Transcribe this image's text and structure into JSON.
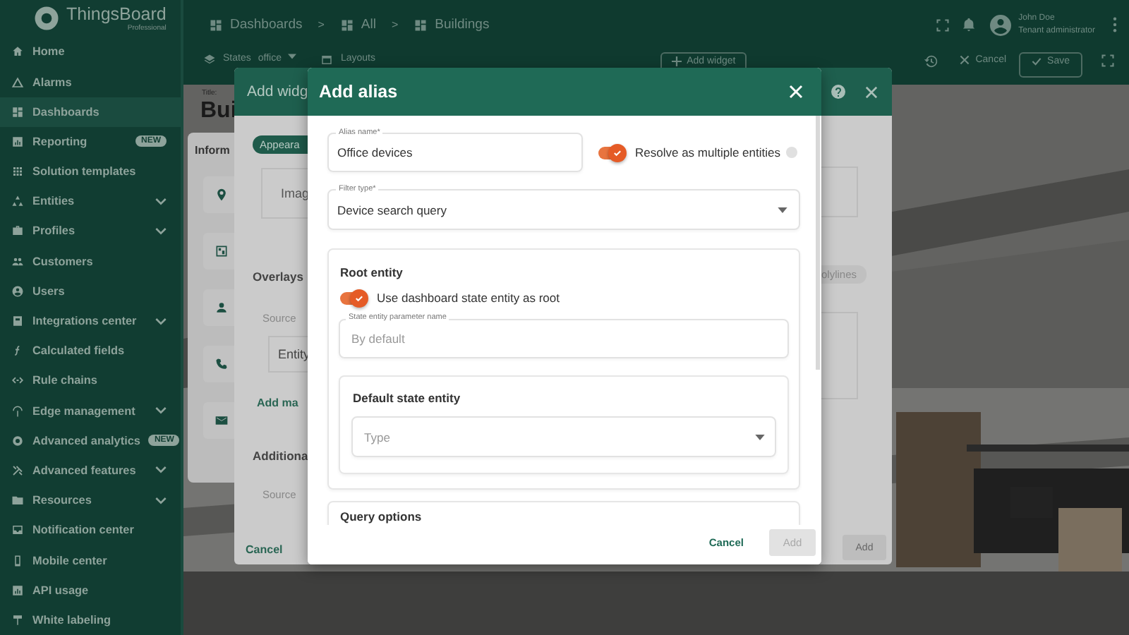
{
  "sidebar": {
    "logo": {
      "name": "ThingsBoard",
      "edition": "Professional"
    },
    "items": [
      {
        "label": "Home",
        "selected": false,
        "submenu": false
      },
      {
        "label": "Alarms",
        "selected": false,
        "submenu": false
      },
      {
        "label": "Dashboards",
        "selected": true,
        "submenu": false
      },
      {
        "label": "Reporting",
        "selected": false,
        "submenu": false,
        "badge": "NEW"
      },
      {
        "label": "Solution templates",
        "selected": false,
        "submenu": false
      },
      {
        "label": "Entities",
        "selected": false,
        "submenu": true
      },
      {
        "label": "Profiles",
        "selected": false,
        "submenu": true
      },
      {
        "label": "Customers",
        "selected": false,
        "submenu": false
      },
      {
        "label": "Users",
        "selected": false,
        "submenu": false
      },
      {
        "label": "Integrations center",
        "selected": false,
        "submenu": true
      },
      {
        "label": "Calculated fields",
        "selected": false,
        "submenu": false
      },
      {
        "label": "Rule chains",
        "selected": false,
        "submenu": false
      },
      {
        "label": "Edge management",
        "selected": false,
        "submenu": true
      },
      {
        "label": "Advanced analytics",
        "selected": false,
        "submenu": false,
        "badge": "NEW"
      },
      {
        "label": "Advanced features",
        "selected": false,
        "submenu": true
      },
      {
        "label": "Resources",
        "selected": false,
        "submenu": true
      },
      {
        "label": "Notification center",
        "selected": false,
        "submenu": false
      },
      {
        "label": "Mobile center",
        "selected": false,
        "submenu": false
      },
      {
        "label": "API usage",
        "selected": false,
        "submenu": false
      },
      {
        "label": "White labeling",
        "selected": false,
        "submenu": false
      }
    ]
  },
  "topbar": {
    "breadcrumbs": [
      {
        "label": "Dashboards"
      },
      {
        "separator": ">",
        "label": "All"
      },
      {
        "separator": ">",
        "label": "Buildings"
      }
    ],
    "user": {
      "name": "John Doe",
      "role": "Tenant administrator"
    }
  },
  "toolbar": {
    "states_label": "States",
    "state": "office",
    "layouts": "Layouts",
    "add_widget": "Add widget",
    "cancel": "Cancel",
    "save": "Save"
  },
  "dashboard": {
    "title_label": "Title:",
    "title": "Bui",
    "card_title": "Inform"
  },
  "widget_dialog": {
    "title": "Add widg",
    "tab": "Appeara",
    "image_label": "Imag",
    "overlays": "Overlays",
    "source": "Source",
    "entity": "Entity",
    "add_link": "Add ma",
    "additional": "Additiona",
    "source_2": "Source",
    "cancel": "Cancel",
    "chip": "olylines",
    "add": "Add"
  },
  "alias_dialog": {
    "title": "Add alias",
    "alias_name": {
      "label": "Alias name*",
      "value": "Office devices"
    },
    "resolve_multiple": {
      "label": "Resolve as multiple entities",
      "on": true
    },
    "filter_type": {
      "label": "Filter type*",
      "value": "Device search query"
    },
    "root_entity": {
      "title": "Root entity",
      "use_state": {
        "label": "Use dashboard state entity as root",
        "on": true
      },
      "param_field": {
        "label": "State entity parameter name",
        "placeholder": "By default"
      },
      "default_state": {
        "title": "Default state entity",
        "type_placeholder": "Type"
      }
    },
    "query_options": {
      "title": "Query options"
    },
    "cancel": "Cancel",
    "add": {
      "label": "Add",
      "disabled": true
    }
  }
}
